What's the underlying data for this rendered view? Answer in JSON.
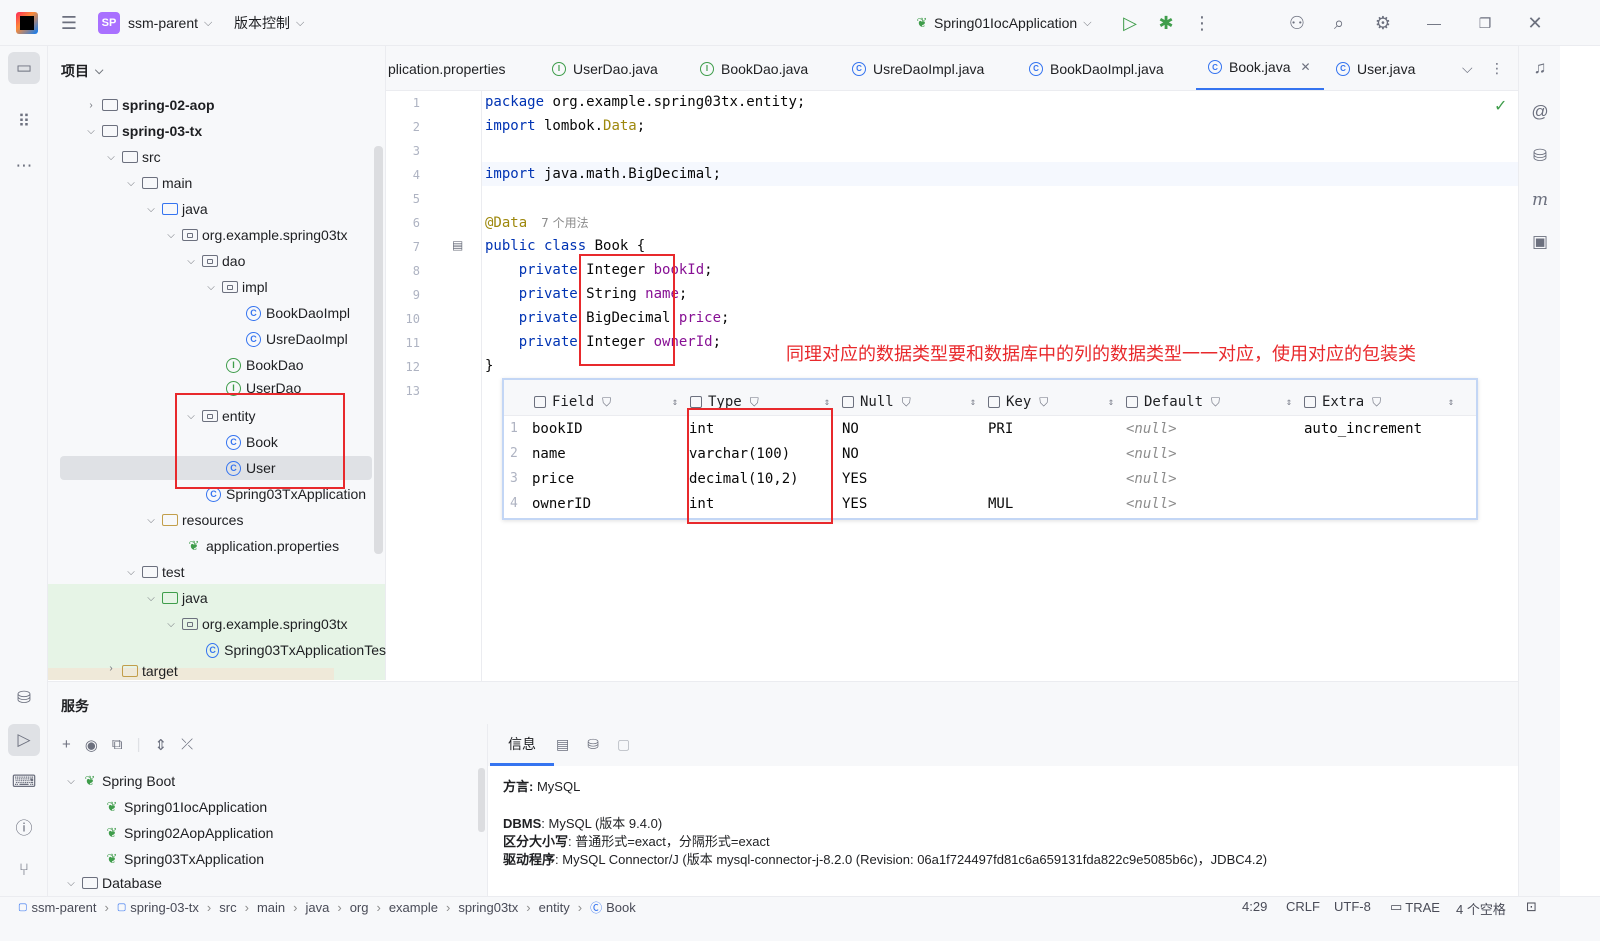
{
  "titlebar": {
    "project_badge": "SP",
    "project_name": "ssm-parent",
    "vcs": "版本控制",
    "run_config": "Spring01IocApplication"
  },
  "project_panel": {
    "title": "项目",
    "tree": [
      {
        "label": "spring-02-aop",
        "bold": true
      },
      {
        "label": "spring-03-tx",
        "bold": true
      },
      {
        "label": "src"
      },
      {
        "label": "main"
      },
      {
        "label": "java"
      },
      {
        "label": "org.example.spring03tx"
      },
      {
        "label": "dao"
      },
      {
        "label": "impl"
      },
      {
        "label": "BookDaoImpl"
      },
      {
        "label": "UsreDaoImpl"
      },
      {
        "label": "BookDao"
      },
      {
        "label": "UserDao"
      },
      {
        "label": "entity"
      },
      {
        "label": "Book"
      },
      {
        "label": "User"
      },
      {
        "label": "Spring03TxApplication"
      },
      {
        "label": "resources"
      },
      {
        "label": "application.properties"
      },
      {
        "label": "test"
      },
      {
        "label": "java"
      },
      {
        "label": "org.example.spring03tx"
      },
      {
        "label": "Spring03TxApplicationTes"
      },
      {
        "label": "target"
      }
    ]
  },
  "tabs": [
    {
      "label": "plication.properties",
      "icon": "spring-icon"
    },
    {
      "label": "UserDao.java",
      "icon": "interface-icon"
    },
    {
      "label": "BookDao.java",
      "icon": "interface-icon"
    },
    {
      "label": "UsreDaoImpl.java",
      "icon": "class-icon"
    },
    {
      "label": "BookDaoImpl.java",
      "icon": "class-icon"
    },
    {
      "label": "Book.java",
      "icon": "class-icon",
      "active": true
    },
    {
      "label": "User.java",
      "icon": "class-icon"
    }
  ],
  "editor": {
    "line_numbers": [
      "1",
      "2",
      "3",
      "4",
      "5",
      "6",
      "7",
      "8",
      "9",
      "10",
      "11",
      "12",
      "13"
    ],
    "usages_hint": "7 个用法",
    "lines": {
      "l1_kw": "package",
      "l1_rest": " org.example.spring03tx.entity;",
      "l2_kw": "import",
      "l2_rest": " lombok.",
      "l2_ann": "Data",
      "l2_end": ";",
      "l4_kw": "import",
      "l4_rest": " java.math.BigDecimal;",
      "l6_ann": "@Data",
      "l7_kw": "public class",
      "l7_rest": " Book {",
      "l8_kw": "private",
      "l8_type": " Integer ",
      "l8_fld": "bookId",
      "l8_end": ";",
      "l9_kw": "private",
      "l9_type": " String ",
      "l9_fld": "name",
      "l9_end": ";",
      "l10_kw": "private",
      "l10_type": " BigDecimal ",
      "l10_fld": "price",
      "l10_end": ";",
      "l11_kw": "private",
      "l11_type": " Integer ",
      "l11_fld": "ownerId",
      "l11_end": ";",
      "l12": "}"
    }
  },
  "annotation_note": "同理对应的数据类型要和数据库中的列的数据类型一一对应，使用对应的包装类",
  "db_table": {
    "columns": [
      "Field",
      "Type",
      "Null",
      "Key",
      "Default",
      "Extra"
    ],
    "rows": [
      {
        "n": "1",
        "field": "bookID",
        "type": "int",
        "null": "NO",
        "key": "PRI",
        "default": "<null>",
        "extra": "auto_increment"
      },
      {
        "n": "2",
        "field": "name",
        "type": "varchar(100)",
        "null": "NO",
        "key": "",
        "default": "<null>",
        "extra": ""
      },
      {
        "n": "3",
        "field": "price",
        "type": "decimal(10,2)",
        "null": "YES",
        "key": "",
        "default": "<null>",
        "extra": ""
      },
      {
        "n": "4",
        "field": "ownerID",
        "type": "int",
        "null": "YES",
        "key": "MUL",
        "default": "<null>",
        "extra": ""
      }
    ]
  },
  "services": {
    "title": "服务",
    "tree": [
      {
        "label": "Spring Boot"
      },
      {
        "label": "Spring01IocApplication"
      },
      {
        "label": "Spring02AopApplication"
      },
      {
        "label": "Spring03TxApplication"
      },
      {
        "label": "Database"
      }
    ],
    "info_tab": "信息",
    "dialect_label": "方言:",
    "dialect_value": " MySQL",
    "dbms_label": "DBMS",
    "dbms_value": ": MySQL (版本 9.4.0)",
    "case_label": "区分大小写",
    "case_value": ": 普通形式=exact，分隔形式=exact",
    "driver_label": "驱动程序",
    "driver_value": ": MySQL Connector/J (版本 mysql-connector-j-8.2.0 (Revision: 06a1f724497fd81c6a659131fda822c9e5085b6c)，JDBC4.2)"
  },
  "statusbar": {
    "breadcrumbs": [
      "ssm-parent",
      "spring-03-tx",
      "src",
      "main",
      "java",
      "org",
      "example",
      "spring03tx",
      "entity",
      "Book"
    ],
    "position": "4:29",
    "line_sep": "CRLF",
    "encoding": "UTF-8",
    "plugin": "TRAE",
    "indent": "4 个空格"
  },
  "colors": {
    "accent": "#3574f0",
    "annotation_red": "#e8292c",
    "keyword": "#0033b3",
    "field": "#871094",
    "ann": "#9e880d"
  }
}
